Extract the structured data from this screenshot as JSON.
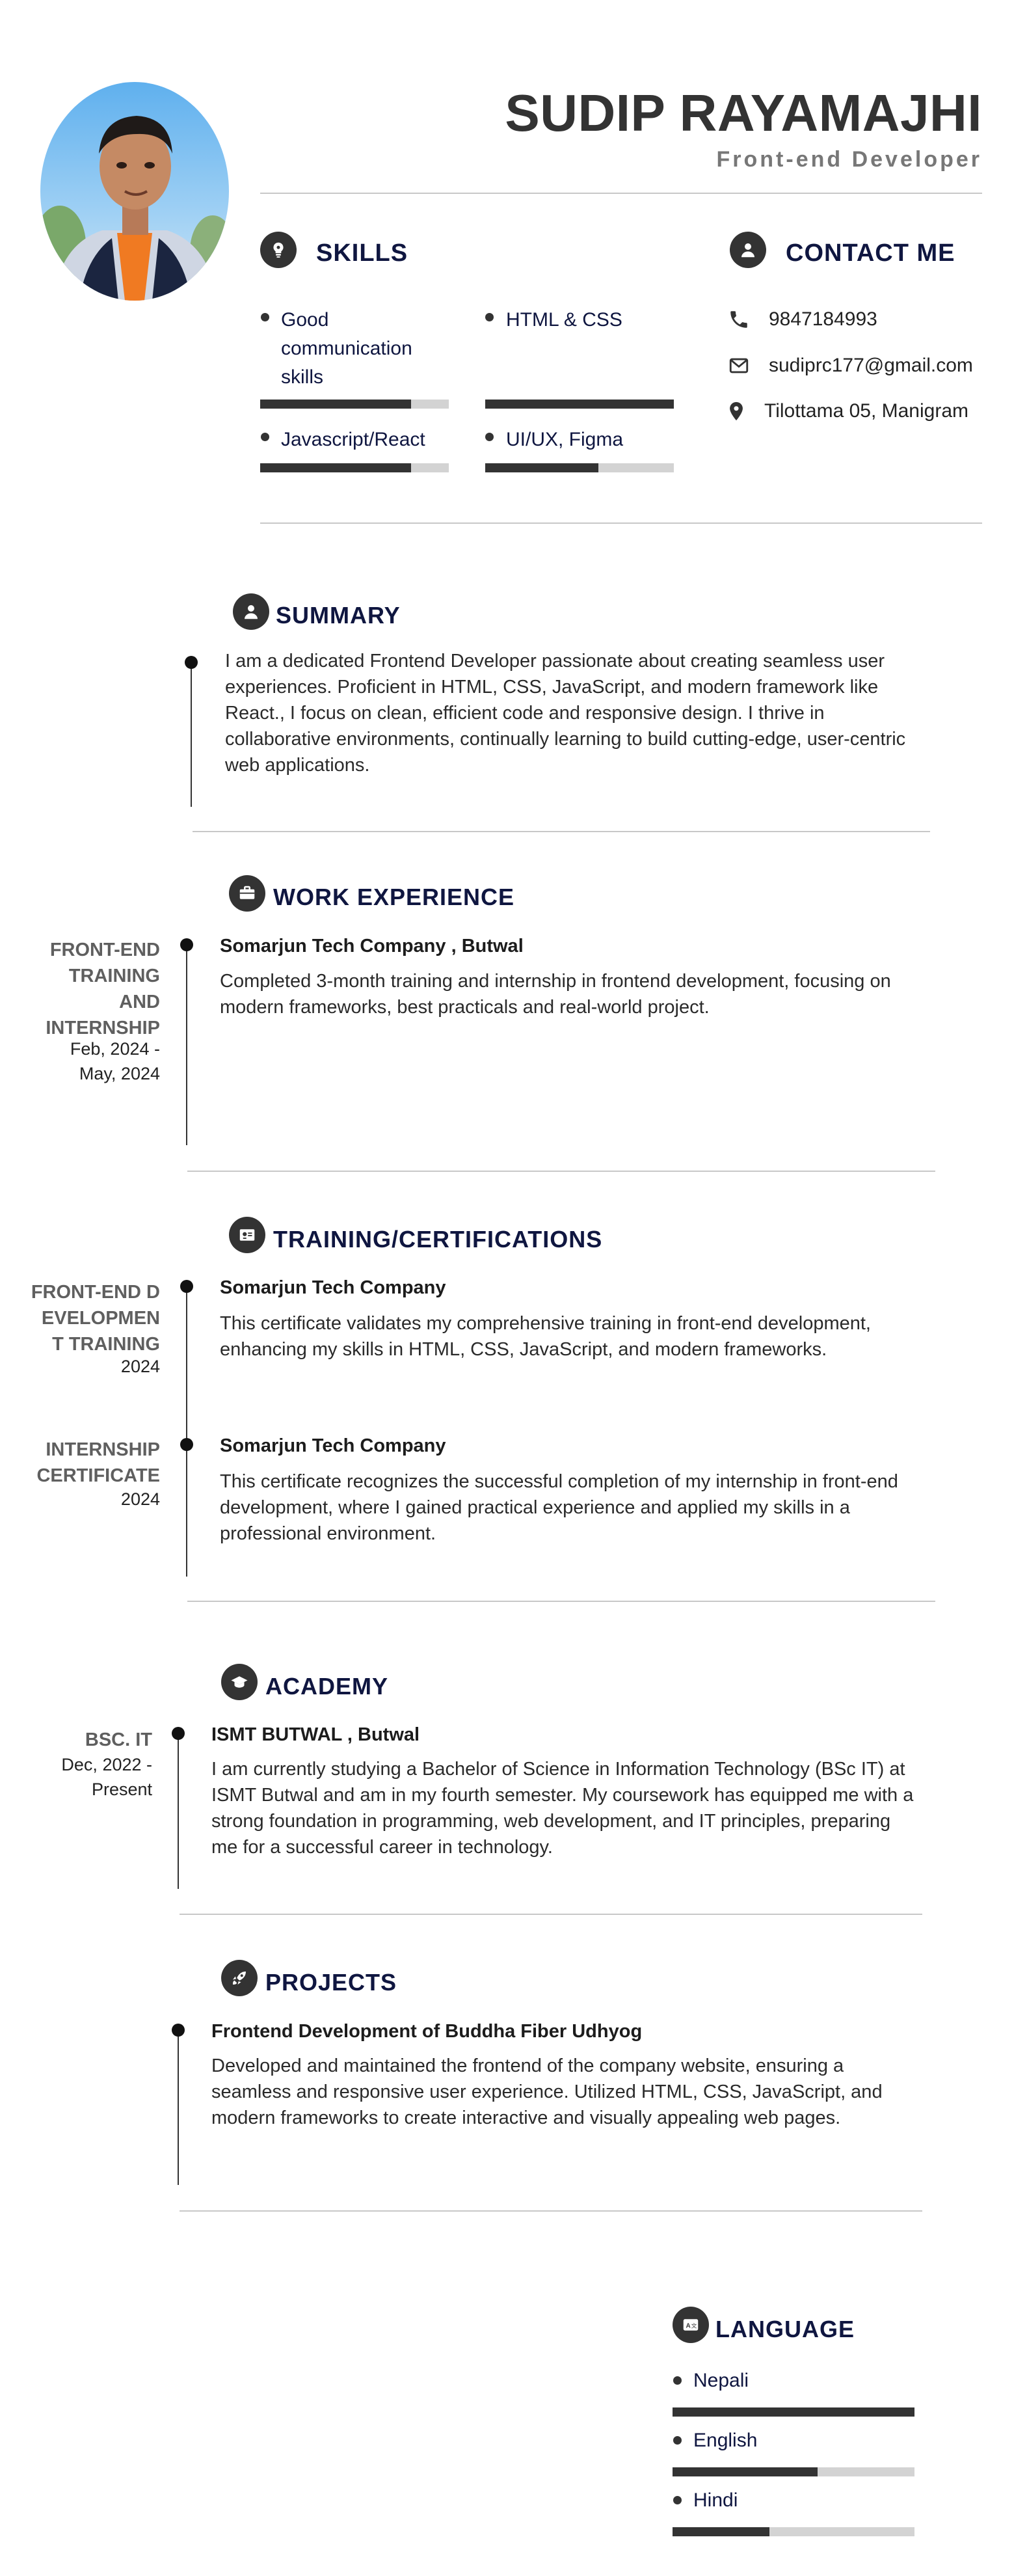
{
  "header": {
    "name": "SUDIP RAYAMAJHI",
    "role": "Front-end Developer",
    "photo_alt": "profile-photo"
  },
  "skills": {
    "title": "SKILLS",
    "icon": "lightbulb-icon",
    "items": [
      {
        "label": "Good communication skills",
        "level": 0.8
      },
      {
        "label": "HTML & CSS",
        "level": 1.0
      },
      {
        "label": "Javascript/React",
        "level": 0.8
      },
      {
        "label": "UI/UX, Figma",
        "level": 0.6
      }
    ]
  },
  "contact": {
    "title": "CONTACT ME",
    "icon": "user-icon",
    "phone": "9847184993",
    "email": "sudiprc177@gmail.com",
    "address": "Tilottama 05, Manigram"
  },
  "summary": {
    "title": "SUMMARY",
    "text": "I am a dedicated Frontend Developer passionate about creating seamless user experiences. Proficient in HTML, CSS, JavaScript, and modern framework like React., I focus on clean, efficient code and responsive design. I thrive in collaborative environments, continually learning to build cutting-edge, user-centric web applications."
  },
  "work": {
    "title": "WORK EXPERIENCE",
    "items": [
      {
        "position": "FRONT-END TRAINING AND INTERNSHIP",
        "date": "Feb, 2024 - May, 2024",
        "company": "Somarjun Tech Company , Butwal",
        "text": "Completed 3-month training and internship in frontend development, focusing on modern frameworks, best practicals and real-world project."
      }
    ]
  },
  "training": {
    "title": "TRAINING/CERTIFICATIONS",
    "items": [
      {
        "position": "FRONT-END DEVELOPMEN T TRAINING",
        "date": "2024",
        "company": "Somarjun Tech Company",
        "text": "This certificate validates my comprehensive training in front-end development, enhancing my skills in HTML, CSS, JavaScript, and modern frameworks."
      },
      {
        "position": "INTERNSHIP CERTIFICATE",
        "date": "2024",
        "company": "Somarjun Tech Company",
        "text": "This certificate recognizes the successful completion of my internship in front-end development, where I gained practical experience and applied my skills in a professional environment."
      }
    ]
  },
  "academy": {
    "title": "ACADEMY",
    "items": [
      {
        "position": "BSC. IT",
        "date": "Dec, 2022 - Present",
        "school": "ISMT BUTWAL , Butwal",
        "text": "I am currently studying a Bachelor of Science in Information Technology (BSc IT) at ISMT Butwal and am in my fourth semester. My coursework has equipped me with a strong foundation in programming, web development, and IT principles, preparing me for a successful career in technology."
      }
    ]
  },
  "projects": {
    "title": "PROJECTS",
    "items": [
      {
        "name": "Frontend Development of Buddha Fiber Udhyog",
        "text": "Developed and maintained the frontend of the company website, ensuring a seamless and responsive user experience. Utilized HTML, CSS, JavaScript, and modern frameworks to create interactive and visually appealing web pages."
      }
    ]
  },
  "language": {
    "title": "LANGUAGE",
    "items": [
      {
        "label": "Nepali",
        "level": 1.0
      },
      {
        "label": "English",
        "level": 0.6
      },
      {
        "label": "Hindi",
        "level": 0.4
      }
    ]
  },
  "colors": {
    "heading": "#0f1640",
    "dark": "#333333",
    "bar_bg": "#d3d3d3"
  }
}
